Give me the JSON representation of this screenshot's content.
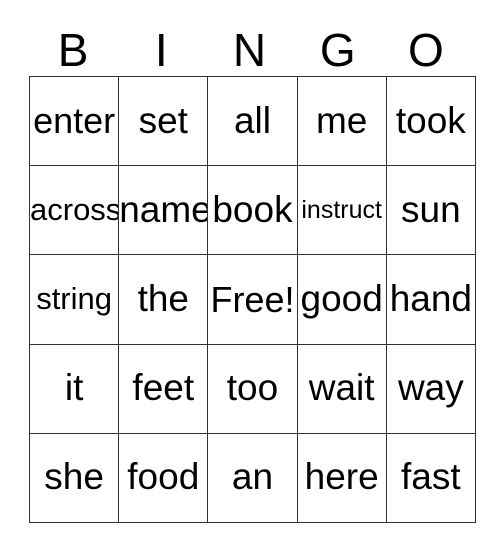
{
  "card": {
    "header": {
      "letters": [
        "B",
        "I",
        "N",
        "G",
        "O"
      ]
    },
    "grid": {
      "rows": [
        [
          {
            "text": "enter"
          },
          {
            "text": "set"
          },
          {
            "text": "all"
          },
          {
            "text": "me"
          },
          {
            "text": "took"
          }
        ],
        [
          {
            "text": "across"
          },
          {
            "text": "name"
          },
          {
            "text": "book"
          },
          {
            "text": "instruct"
          },
          {
            "text": "sun"
          }
        ],
        [
          {
            "text": "string"
          },
          {
            "text": "the"
          },
          {
            "text": "Free!"
          },
          {
            "text": "good"
          },
          {
            "text": "hand"
          }
        ],
        [
          {
            "text": "it"
          },
          {
            "text": "feet"
          },
          {
            "text": "too"
          },
          {
            "text": "wait"
          },
          {
            "text": "way"
          }
        ],
        [
          {
            "text": "she"
          },
          {
            "text": "food"
          },
          {
            "text": "an"
          },
          {
            "text": "here"
          },
          {
            "text": "fast"
          }
        ]
      ]
    },
    "colors": {
      "background": "#ffffff",
      "text": "#000000",
      "grid_line": "#333333"
    }
  }
}
